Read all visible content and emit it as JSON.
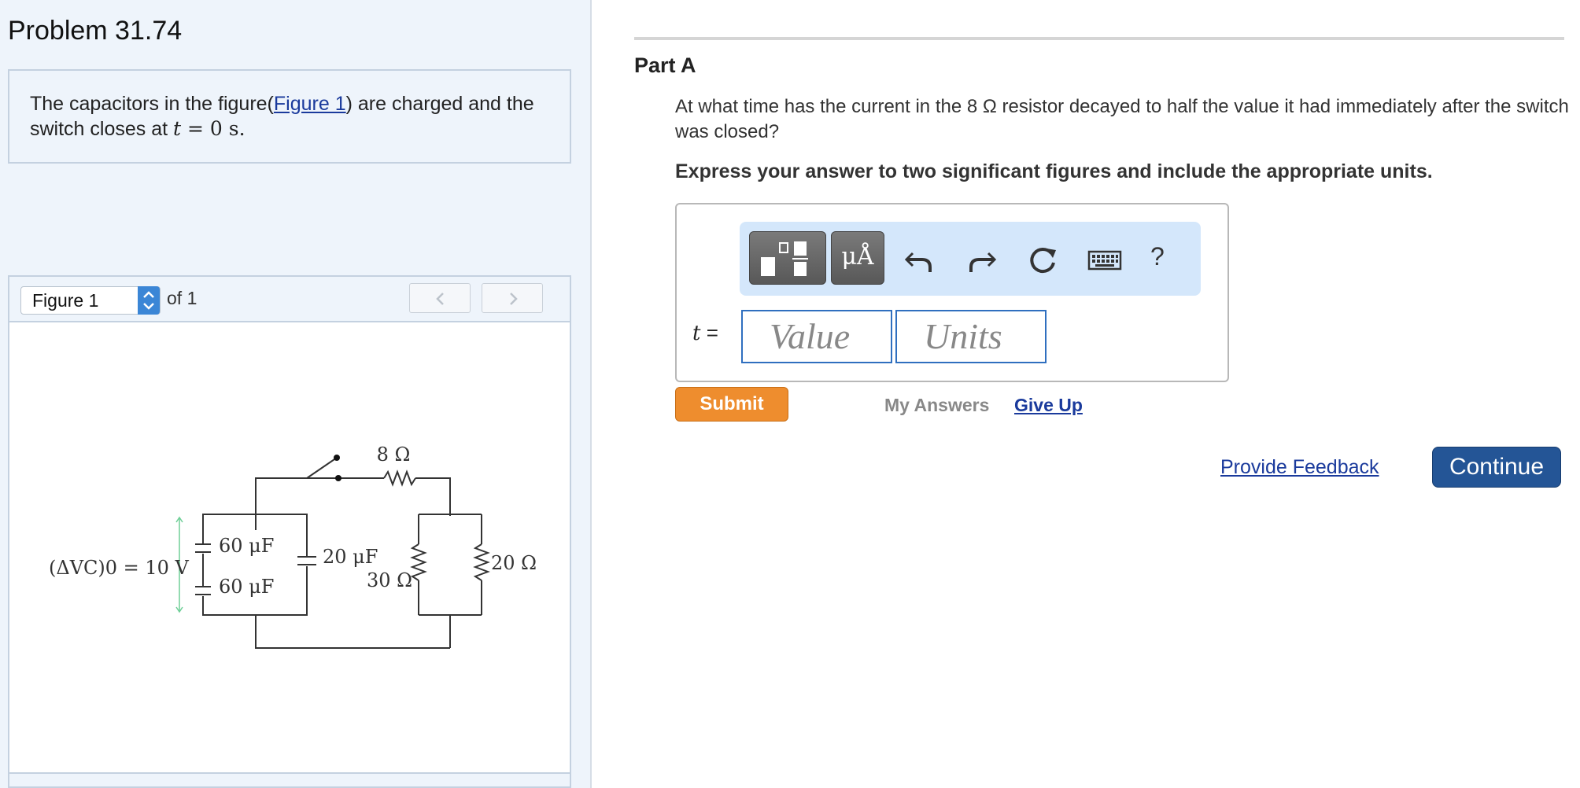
{
  "problem": {
    "title": "Problem 31.74",
    "statement_prefix": "The capacitors in the figure(",
    "figure_link": "Figure 1",
    "statement_mid": ") are charged and the switch closes at ",
    "time_var": "t",
    "time_eq": " = 0 s."
  },
  "figure": {
    "selected": "Figure 1",
    "of_label": "of 1",
    "labels": {
      "r8": "8 Ω",
      "c60a": "60 μF",
      "c60b": "60 μF",
      "c20": "20 μF",
      "r30": "30 Ω",
      "r20": "20 Ω",
      "vc0": "(ΔVC)0 = 10 V"
    }
  },
  "part_a": {
    "title": "Part A",
    "question": "At what time has the current in the 8 Ω resistor decayed to half the value it had immediately after the switch was closed?",
    "instruction": "Express your answer to two significant figures and include the appropriate units.",
    "units_button": "μÅ",
    "help_button": "?",
    "variable": "t",
    "equals": "=",
    "value_placeholder": "Value",
    "units_placeholder": "Units",
    "submit": "Submit",
    "my_answers": "My Answers",
    "give_up": "Give Up"
  },
  "footer": {
    "feedback": "Provide Feedback",
    "continue": "Continue"
  },
  "colors": {
    "left_bg": "#eef4fb",
    "submit_orange": "#ee8d2e",
    "continue_blue": "#245596",
    "link_blue": "#1a3a9c",
    "toolbar_bg": "#d4e7fb"
  }
}
